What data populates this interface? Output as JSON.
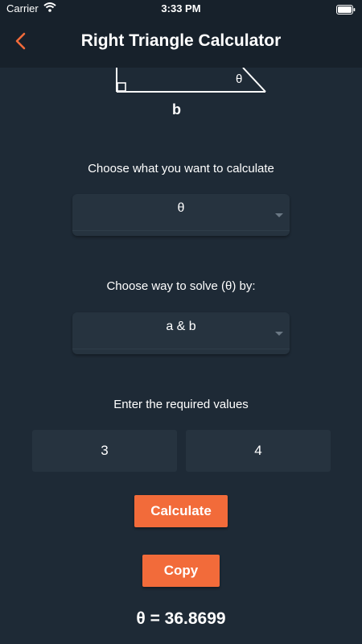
{
  "status_bar": {
    "carrier": "Carrier",
    "time": "3:33 PM",
    "icons": [
      "wifi-icon",
      "battery-icon"
    ]
  },
  "nav": {
    "back_icon": "chevron-left-icon",
    "title": "Right Triangle Calculator"
  },
  "diagram": {
    "side_b_label": "b",
    "angle_label": "θ"
  },
  "calculate_what": {
    "label": "Choose what you want to calculate",
    "selected": "θ"
  },
  "solve_by": {
    "label": "Choose way to solve (θ) by:",
    "selected": "a & b"
  },
  "inputs": {
    "label": "Enter the required values",
    "value_a": "3",
    "value_b": "4"
  },
  "buttons": {
    "calculate": "Calculate",
    "copy": "Copy"
  },
  "result": "θ = 36.8699",
  "colors": {
    "background": "#1e2a36",
    "bar": "#17212b",
    "field": "#26333f",
    "accent": "#f26b3a"
  }
}
